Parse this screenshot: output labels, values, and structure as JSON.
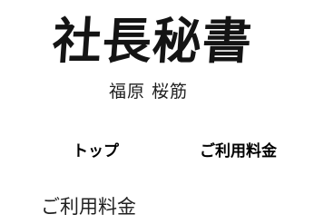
{
  "header": {
    "logo_title": "社長秘書",
    "logo_subtitle": "福原 桜筋"
  },
  "nav": {
    "items": [
      {
        "label": "トップ"
      },
      {
        "label": "ご利用料金"
      }
    ]
  },
  "main": {
    "heading": "ご利用料金"
  }
}
